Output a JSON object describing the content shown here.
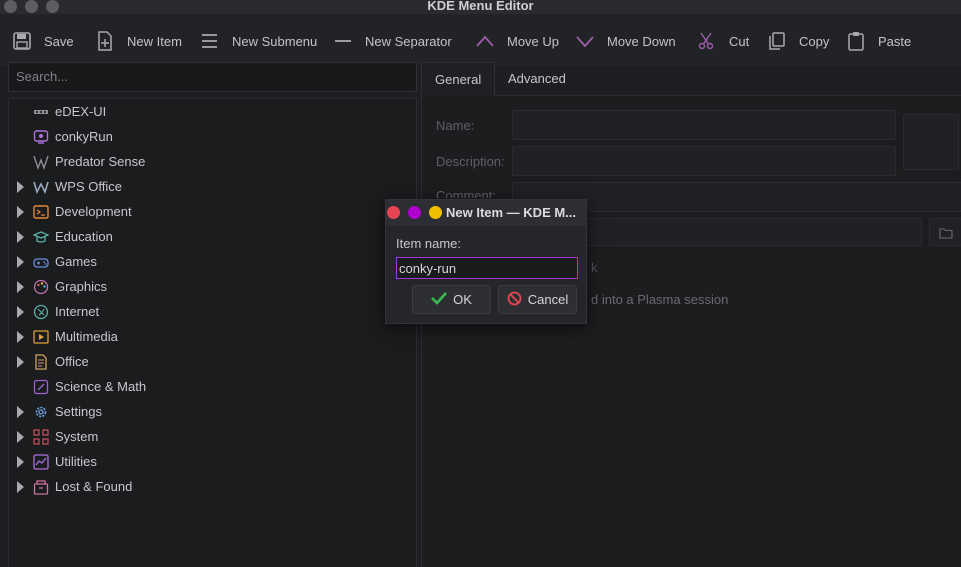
{
  "window": {
    "title": "KDE Menu Editor"
  },
  "toolbar": {
    "save": "Save",
    "new_item": "New Item",
    "new_submenu": "New Submenu",
    "new_separator": "New Separator",
    "move_up": "Move Up",
    "move_down": "Move Down",
    "cut": "Cut",
    "copy": "Copy",
    "paste": "Paste"
  },
  "search": {
    "placeholder": "Search..."
  },
  "tree": {
    "items": [
      {
        "label": "eDEX-UI",
        "expandable": false,
        "icon": "edex-icon"
      },
      {
        "label": "conkyRun",
        "expandable": false,
        "icon": "conky-icon"
      },
      {
        "label": "Predator Sense",
        "expandable": false,
        "icon": "predator-icon"
      },
      {
        "label": "WPS Office",
        "expandable": true,
        "icon": "wps-icon"
      },
      {
        "label": "Development",
        "expandable": true,
        "icon": "terminal-icon"
      },
      {
        "label": "Education",
        "expandable": true,
        "icon": "graduation-cap-icon"
      },
      {
        "label": "Games",
        "expandable": true,
        "icon": "gamepad-icon"
      },
      {
        "label": "Graphics",
        "expandable": true,
        "icon": "palette-icon"
      },
      {
        "label": "Internet",
        "expandable": true,
        "icon": "globe-icon"
      },
      {
        "label": "Multimedia",
        "expandable": true,
        "icon": "media-icon"
      },
      {
        "label": "Office",
        "expandable": true,
        "icon": "office-icon"
      },
      {
        "label": "Science & Math",
        "expandable": false,
        "icon": "science-icon"
      },
      {
        "label": "Settings",
        "expandable": true,
        "icon": "gear-icon"
      },
      {
        "label": "System",
        "expandable": true,
        "icon": "system-grid-icon"
      },
      {
        "label": "Utilities",
        "expandable": true,
        "icon": "chart-line-icon"
      },
      {
        "label": "Lost & Found",
        "expandable": true,
        "icon": "box-icon"
      }
    ]
  },
  "tabs": {
    "general": "General",
    "advanced": "Advanced"
  },
  "form": {
    "name_label": "Name:",
    "description_label": "Description:",
    "comment_label": "Comment:",
    "partial_k": "k",
    "plasma_text": "d into a Plasma session"
  },
  "dialog": {
    "title": "New Item — KDE M...",
    "item_name_label": "Item name:",
    "item_name_value": "conky-run",
    "ok": "OK",
    "cancel": "Cancel"
  },
  "colors": {
    "accent": "#a13ad4",
    "dot_red": "#e64553",
    "dot_purple": "#b000d0",
    "dot_yellow": "#f0c000",
    "icon_purple": "#b070e0"
  }
}
